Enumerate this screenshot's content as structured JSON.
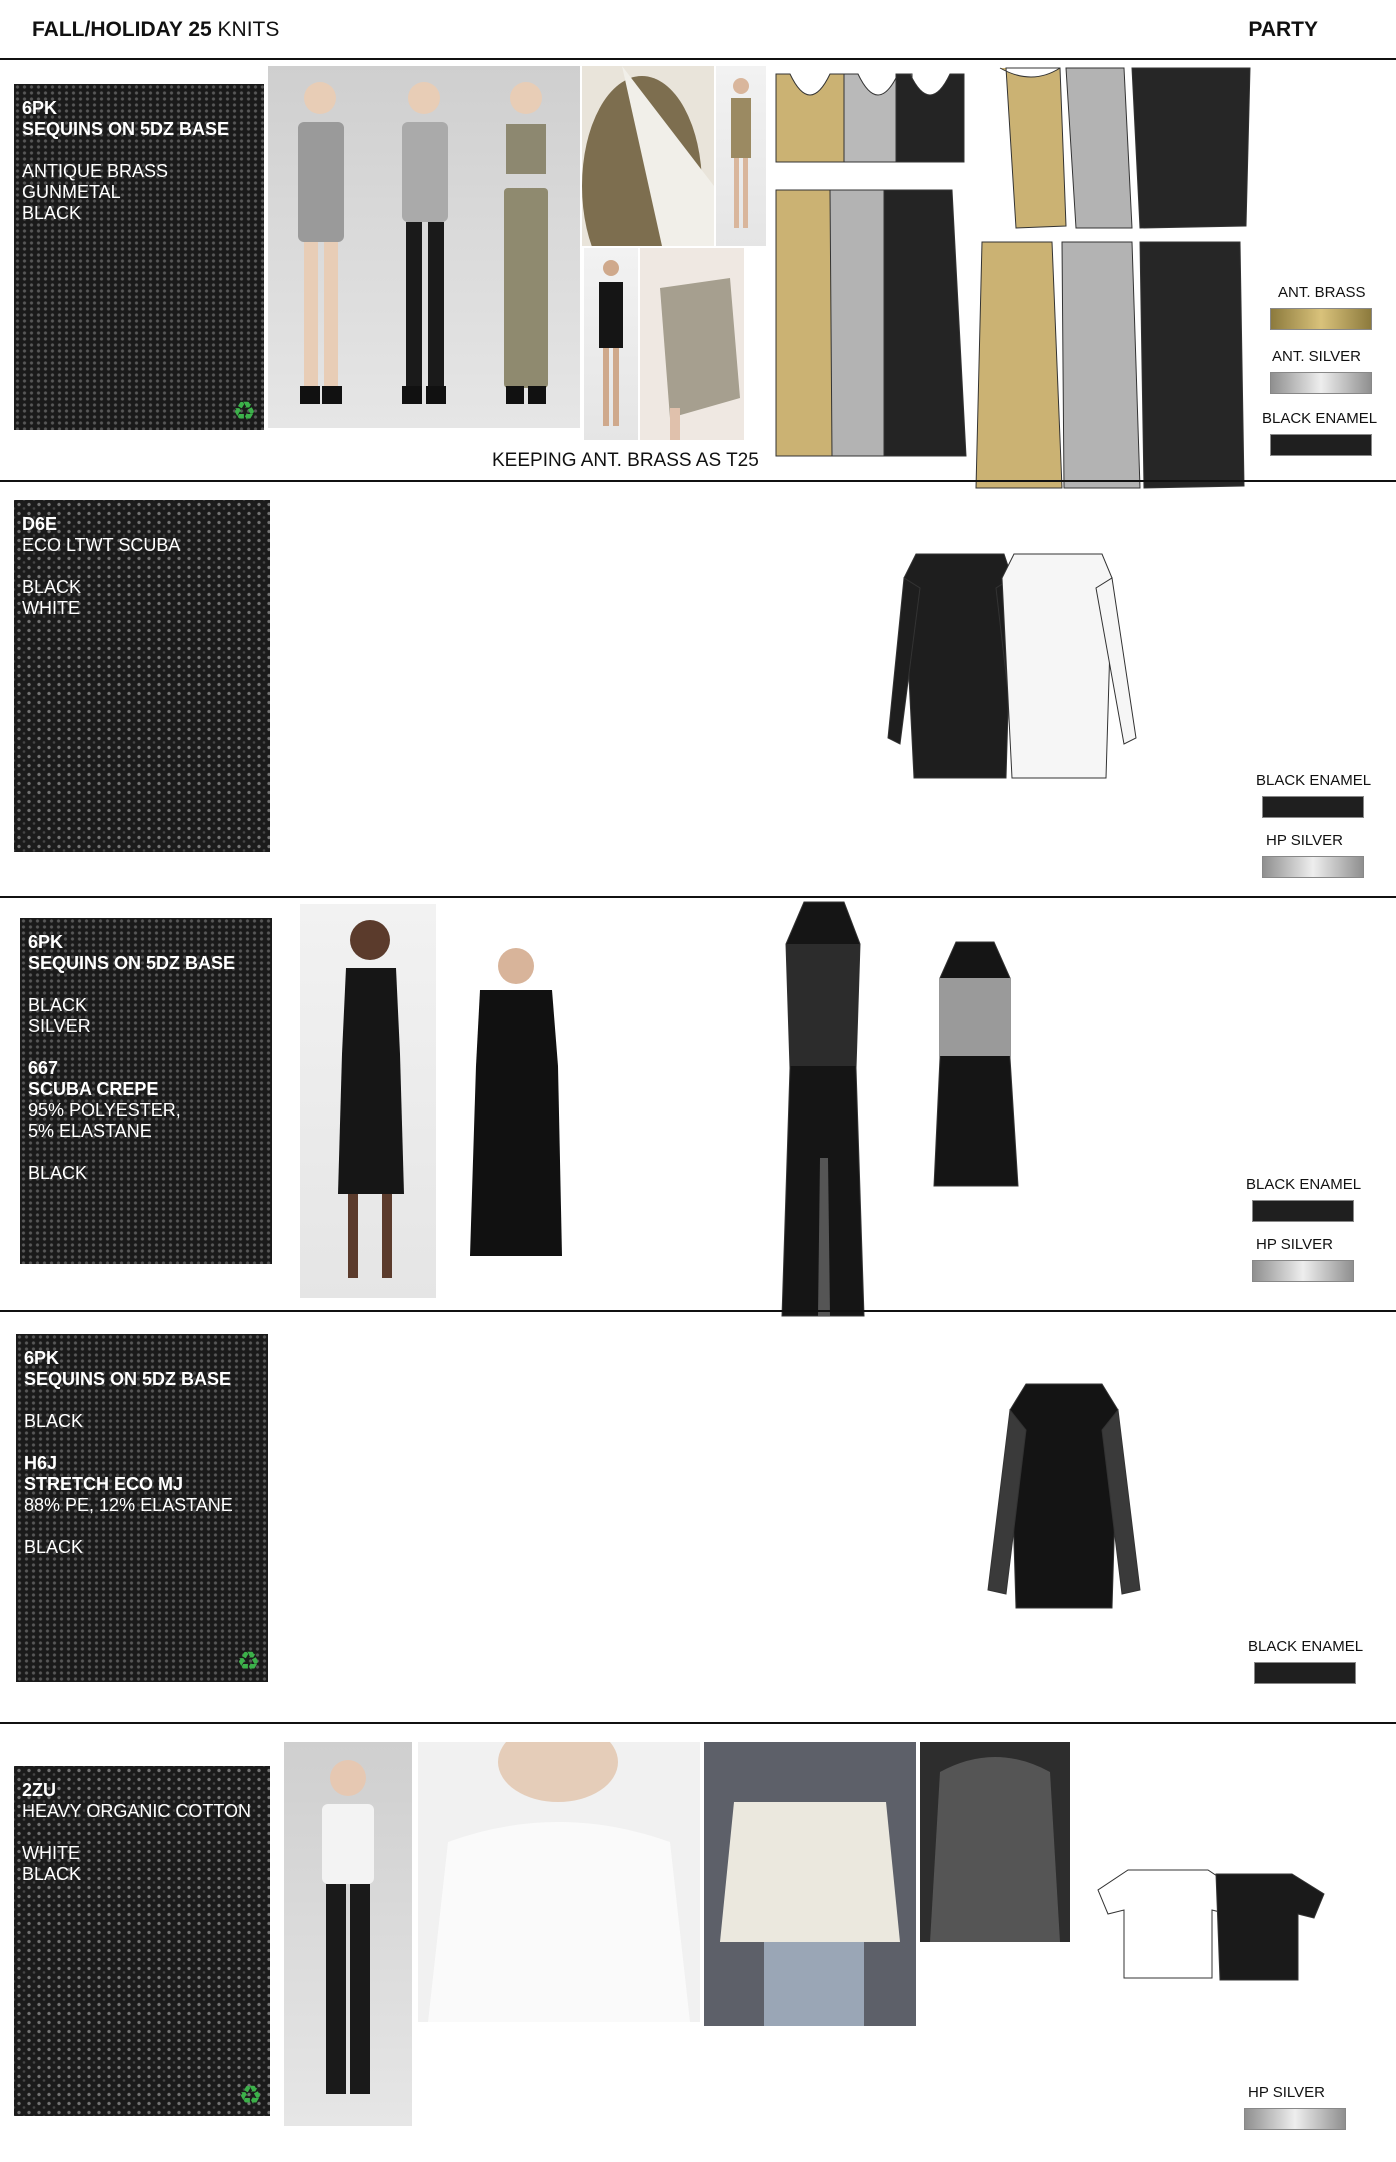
{
  "header": {
    "season_bold": "FALL/HOLIDAY 25",
    "season_rest": " KNITS",
    "category": "PARTY"
  },
  "sections": [
    {
      "swatch_lines": [
        "6PK",
        "SEQUINS ON 5DZ BASE",
        "",
        "ANTIQUE BRASS",
        "GUNMETAL",
        "BLACK"
      ],
      "note": "KEEPING ANT. BRASS AS T25",
      "chips": [
        {
          "label": "ANT. BRASS",
          "color": "#c9b06a"
        },
        {
          "label": "ANT. SILVER",
          "color": "#c8c8c8"
        },
        {
          "label": "BLACK ENAMEL",
          "color": "#1e1e1e"
        }
      ]
    },
    {
      "swatch_lines": [
        "D6E",
        "ECO LTWT SCUBA",
        "",
        "BLACK",
        "WHITE"
      ],
      "chips": [
        {
          "label": "BLACK ENAMEL",
          "color": "#1e1e1e"
        },
        {
          "label": "HP SILVER",
          "color": "#c8c8c8"
        }
      ]
    },
    {
      "swatch_lines": [
        "6PK",
        "SEQUINS ON 5DZ BASE",
        "",
        "BLACK",
        "SILVER",
        "",
        "667",
        "SCUBA CREPE",
        "95% POLYESTER,",
        "5% ELASTANE",
        "",
        "BLACK"
      ],
      "chips": [
        {
          "label": "BLACK ENAMEL",
          "color": "#1e1e1e"
        },
        {
          "label": "HP SILVER",
          "color": "#c8c8c8"
        }
      ]
    },
    {
      "swatch_lines": [
        "6PK",
        "SEQUINS ON 5DZ BASE",
        "",
        "BLACK",
        "",
        "H6J",
        "STRETCH ECO MJ",
        "88% PE, 12% ELASTANE",
        "",
        "BLACK"
      ],
      "chips": [
        {
          "label": "BLACK ENAMEL",
          "color": "#1e1e1e"
        }
      ]
    },
    {
      "swatch_lines": [
        "2ZU",
        "HEAVY ORGANIC COTTON",
        "",
        "WHITE",
        "BLACK"
      ],
      "chips": [
        {
          "label": "HP SILVER",
          "color": "#c8c8c8"
        }
      ]
    }
  ],
  "colors": {
    "brass": "#c9b06a",
    "silver": "#b9b9b9",
    "black": "#1b1b1b",
    "recycle": "#3cb14a"
  },
  "icons": {
    "recycle": "recycle-icon"
  }
}
